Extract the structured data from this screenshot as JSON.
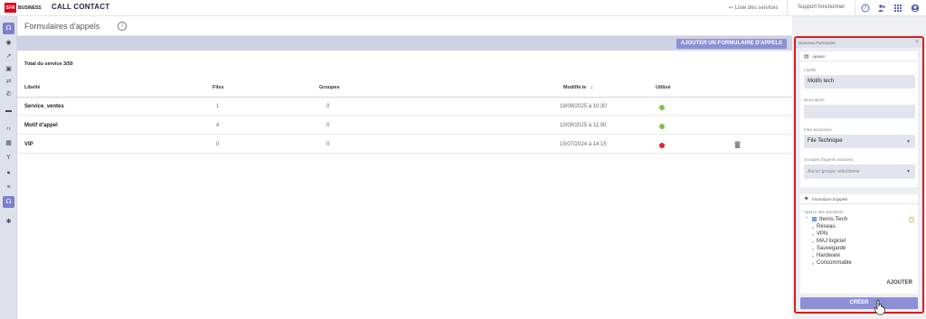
{
  "brand": {
    "logo_mark": "SFR",
    "logo_text": "BUSINESS",
    "app_name": "CALL CONTACT"
  },
  "topbar": {
    "services_link": "↩ Liste des services",
    "support_link": "Support fonctionnel",
    "icons": [
      "help-icon",
      "users-icon",
      "apps-grid-icon",
      "account-icon"
    ]
  },
  "rail": {
    "items": [
      "headset-icon",
      "eye-icon",
      "trend-icon",
      "building-icon",
      "routing-icon",
      "phone-forward-icon",
      "folder-icon",
      "code-icon",
      "calendar-icon",
      "branch-icon",
      "chat-icon",
      "queue-icon",
      "headset-active-icon",
      "gear-icon"
    ]
  },
  "header": {
    "title": "Formulaires d'appels",
    "info": "i"
  },
  "actionbar": {
    "add_button": "AJOUTER UN FORMULAIRE D'APPELS"
  },
  "table": {
    "total": "Total du service 3/50",
    "columns": {
      "libelle": "Libellé",
      "files": "Files",
      "groupes": "Groupes",
      "modifie": "Modifié le",
      "utilise": "Utilisé"
    },
    "rows": [
      {
        "libelle": "Service_ventes",
        "files": "1",
        "groupes": "0",
        "modifie": "18/09/2025 à 10:30",
        "status": "green"
      },
      {
        "libelle": "Motif d'appel",
        "files": "4",
        "groupes": "0",
        "modifie": "10/09/2025 à 11:00",
        "status": "green"
      },
      {
        "libelle": "VIP",
        "files": "0",
        "groupes": "0",
        "modifie": "15/07/2024 à 14:15",
        "status": "red"
      }
    ]
  },
  "colors": {
    "green": "#7dc540",
    "red": "#e3242b",
    "accent": "#8c90d6",
    "highlight": "#d91c1c"
  },
  "panel": {
    "title": "Nouveau Formulaire",
    "section_add": "Ajouter",
    "libelle_label": "Libellé",
    "libelle_value": "Motifs tech",
    "description_label": "Description",
    "description_value": "",
    "files_label": "Files associées",
    "files_value": "File Technique",
    "groups_label": "Groupes d'agents associés",
    "groups_placeholder": "Aucun groupe sélectionné",
    "section_form": "Formulaire d'appels",
    "preview_label": "Aperçu des questions",
    "tree_root": "Items Tech",
    "tree_children": [
      "Réseau",
      "VPN",
      "MAJ logiciel",
      "Sauvegarde",
      "Hardware",
      "Consommable"
    ],
    "ajouter_label": "AJOUTER",
    "create_button": "CRÉER"
  }
}
